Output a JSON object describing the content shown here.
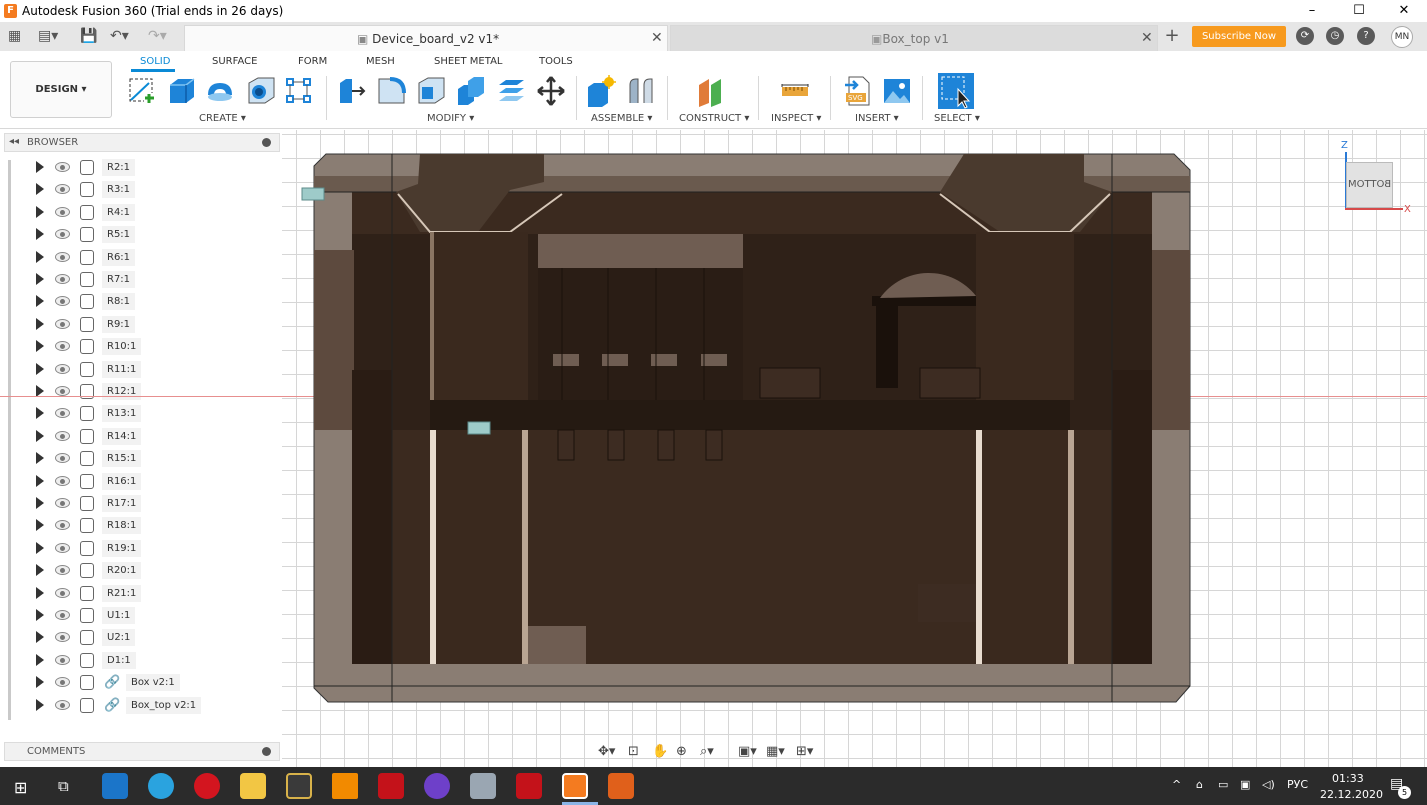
{
  "window": {
    "title": "Autodesk Fusion 360 (Trial ends in 26 days)",
    "logo_letter": "F",
    "minimize": "–",
    "maximize": "☐",
    "close": "✕"
  },
  "tabs": [
    {
      "label": "Device_board_v2 v1*",
      "close": "✕"
    },
    {
      "label": "Box_top v1",
      "close": "✕"
    }
  ],
  "header": {
    "new_tab": "+",
    "subscribe_label": "Subscribe Now",
    "user_initials": "MN"
  },
  "toolbar": {
    "workspace": "DESIGN ▾",
    "tabs": [
      "SOLID",
      "SURFACE",
      "FORM",
      "MESH",
      "SHEET METAL",
      "TOOLS"
    ],
    "groups": [
      "CREATE ▾",
      "MODIFY ▾",
      "ASSEMBLE ▾",
      "CONSTRUCT ▾",
      "INSPECT ▾",
      "INSERT ▾",
      "SELECT ▾"
    ]
  },
  "browser": {
    "title": "BROWSER",
    "collapse": "◂◂",
    "items": [
      {
        "label": "R2:1",
        "linked": false
      },
      {
        "label": "R3:1",
        "linked": false
      },
      {
        "label": "R4:1",
        "linked": false
      },
      {
        "label": "R5:1",
        "linked": false
      },
      {
        "label": "R6:1",
        "linked": false
      },
      {
        "label": "R7:1",
        "linked": false
      },
      {
        "label": "R8:1",
        "linked": false
      },
      {
        "label": "R9:1",
        "linked": false
      },
      {
        "label": "R10:1",
        "linked": false
      },
      {
        "label": "R11:1",
        "linked": false
      },
      {
        "label": "R12:1",
        "linked": false
      },
      {
        "label": "R13:1",
        "linked": false
      },
      {
        "label": "R14:1",
        "linked": false
      },
      {
        "label": "R15:1",
        "linked": false
      },
      {
        "label": "R16:1",
        "linked": false
      },
      {
        "label": "R17:1",
        "linked": false
      },
      {
        "label": "R18:1",
        "linked": false
      },
      {
        "label": "R19:1",
        "linked": false
      },
      {
        "label": "R20:1",
        "linked": false
      },
      {
        "label": "R21:1",
        "linked": false
      },
      {
        "label": "U1:1",
        "linked": false
      },
      {
        "label": "U2:1",
        "linked": false
      },
      {
        "label": "D1:1",
        "linked": false
      },
      {
        "label": "Box v2:1",
        "linked": true
      },
      {
        "label": "Box_top v2:1",
        "linked": true
      }
    ]
  },
  "comments": {
    "title": "COMMENTS"
  },
  "viewcube": {
    "face": "BOTTOM",
    "axis_z": "Z",
    "axis_x": "X"
  },
  "taskbar": {
    "language": "РУС",
    "time": "01:33",
    "date": "22.12.2020",
    "notifications": "5"
  },
  "colors": {
    "accent": "#0a8ad6",
    "subscribe": "#f79a1e",
    "taskbar": "#2b2b2b"
  }
}
